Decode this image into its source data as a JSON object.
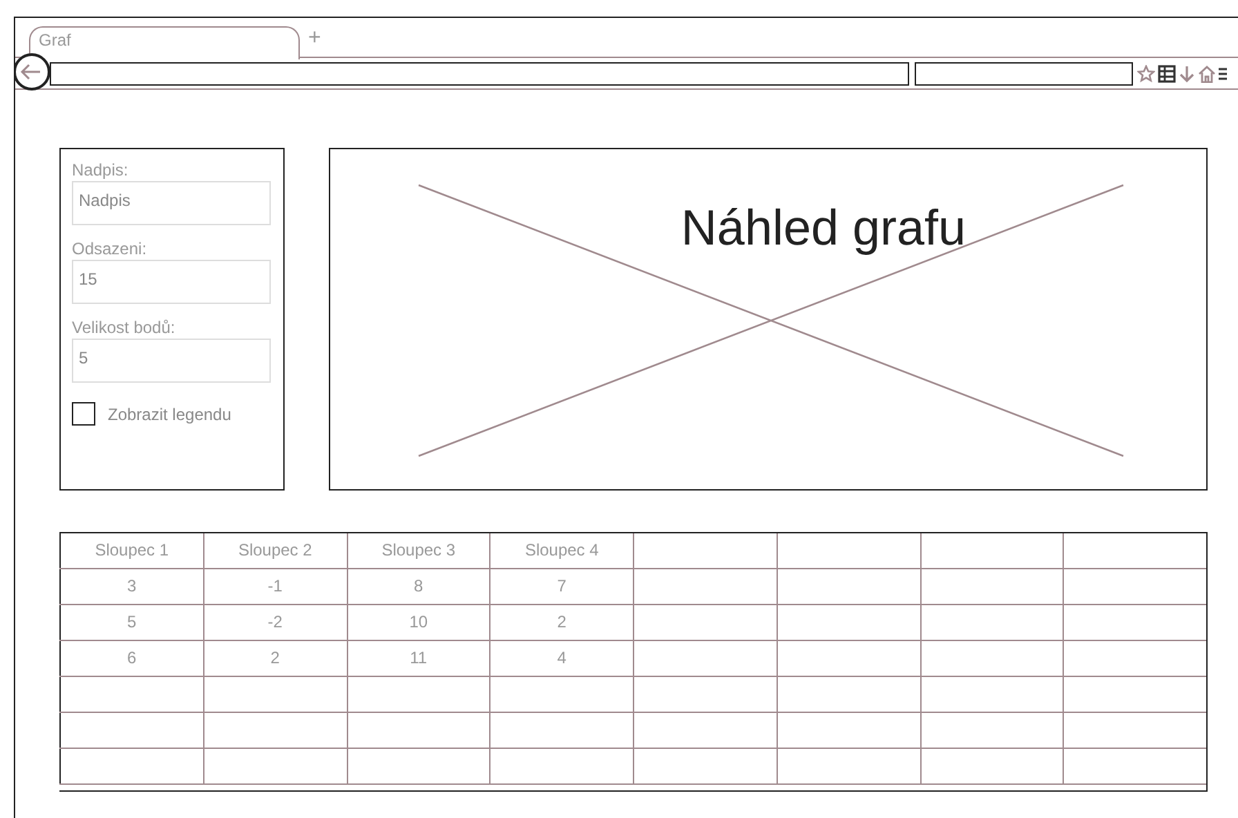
{
  "tabs": [
    {
      "label": "Graf",
      "selected": true
    }
  ],
  "new_tab": "+",
  "form": {
    "fields": [
      {
        "label": "Nadpis:",
        "value": "Nadpis"
      },
      {
        "label": "Odsazeni:",
        "value": "15"
      },
      {
        "label": "Velikost bodů:",
        "value": "5"
      }
    ],
    "legend_checkbox": {
      "label": "Zobrazit legendu",
      "checked": false
    }
  },
  "preview": {
    "title": "Náhled grafu"
  },
  "table": {
    "columns": [
      "Sloupec 1",
      "Sloupec 2",
      "Sloupec 3",
      "Sloupec 4"
    ],
    "rows": [
      [
        "3",
        "-1",
        "8",
        "7"
      ],
      [
        "5",
        "-2",
        "10",
        "2"
      ],
      [
        "6",
        "2",
        "11",
        "4"
      ]
    ]
  }
}
